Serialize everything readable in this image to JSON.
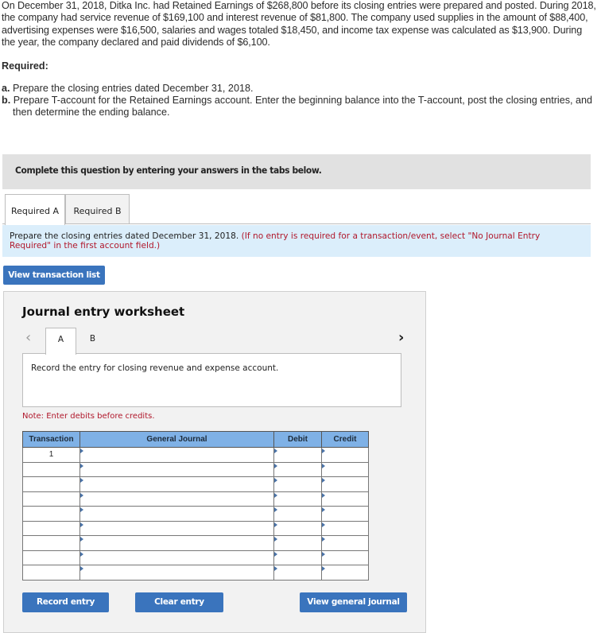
{
  "problem": {
    "text": "On December 31, 2018, Ditka Inc. had Retained Earnings of $268,800 before its closing entries were prepared and posted. During 2018, the company had service revenue of $169,100 and interest revenue of $81,800. The company used supplies in the amount of $88,400, advertising expenses were $16,500, salaries and wages totaled $18,450, and income tax expense was calculated as $13,900. During the year, the company declared and paid dividends of $6,100."
  },
  "required": {
    "heading": "Required:",
    "items": [
      {
        "marker": "a.",
        "text": "Prepare the closing entries dated December 31, 2018."
      },
      {
        "marker": "b.",
        "text": "Prepare T-account for the Retained Earnings account. Enter the beginning balance into the T-account, post the closing entries, and then determine the ending balance."
      }
    ]
  },
  "banner": "Complete this question by entering your answers in the tabs below.",
  "tabs": [
    {
      "label": "Required A",
      "active": true
    },
    {
      "label": "Required B",
      "active": false
    }
  ],
  "instruction": {
    "main": "Prepare the closing entries dated December 31, 2018.",
    "note": "(If no entry is required for a transaction/event, select \"No Journal Entry Required\" in the first account field.)"
  },
  "buttons": {
    "view_transaction_list": "View transaction list",
    "record_entry": "Record entry",
    "clear_entry": "Clear entry",
    "view_general_journal": "View general journal"
  },
  "worksheet": {
    "title": "Journal entry worksheet",
    "prev_icon": "‹",
    "next_icon": "›",
    "entry_tabs": [
      "A",
      "B"
    ],
    "description": "Record the entry for closing revenue and expense account.",
    "note": "Note: Enter debits before credits.",
    "columns": [
      "Transaction",
      "General Journal",
      "Debit",
      "Credit"
    ],
    "rows": [
      {
        "transaction": "1",
        "account": "",
        "debit": "",
        "credit": ""
      },
      {
        "transaction": "",
        "account": "",
        "debit": "",
        "credit": ""
      },
      {
        "transaction": "",
        "account": "",
        "debit": "",
        "credit": ""
      },
      {
        "transaction": "",
        "account": "",
        "debit": "",
        "credit": ""
      },
      {
        "transaction": "",
        "account": "",
        "debit": "",
        "credit": ""
      },
      {
        "transaction": "",
        "account": "",
        "debit": "",
        "credit": ""
      },
      {
        "transaction": "",
        "account": "",
        "debit": "",
        "credit": ""
      },
      {
        "transaction": "",
        "account": "",
        "debit": "",
        "credit": ""
      },
      {
        "transaction": "",
        "account": "",
        "debit": "",
        "credit": ""
      }
    ]
  },
  "colors": {
    "button_blue": "#3a74bd",
    "header_blue": "#7fb1e6",
    "note_red": "#b0172b",
    "instruction_bg": "#dbeefb",
    "banner_bg": "#e1e1e1"
  }
}
